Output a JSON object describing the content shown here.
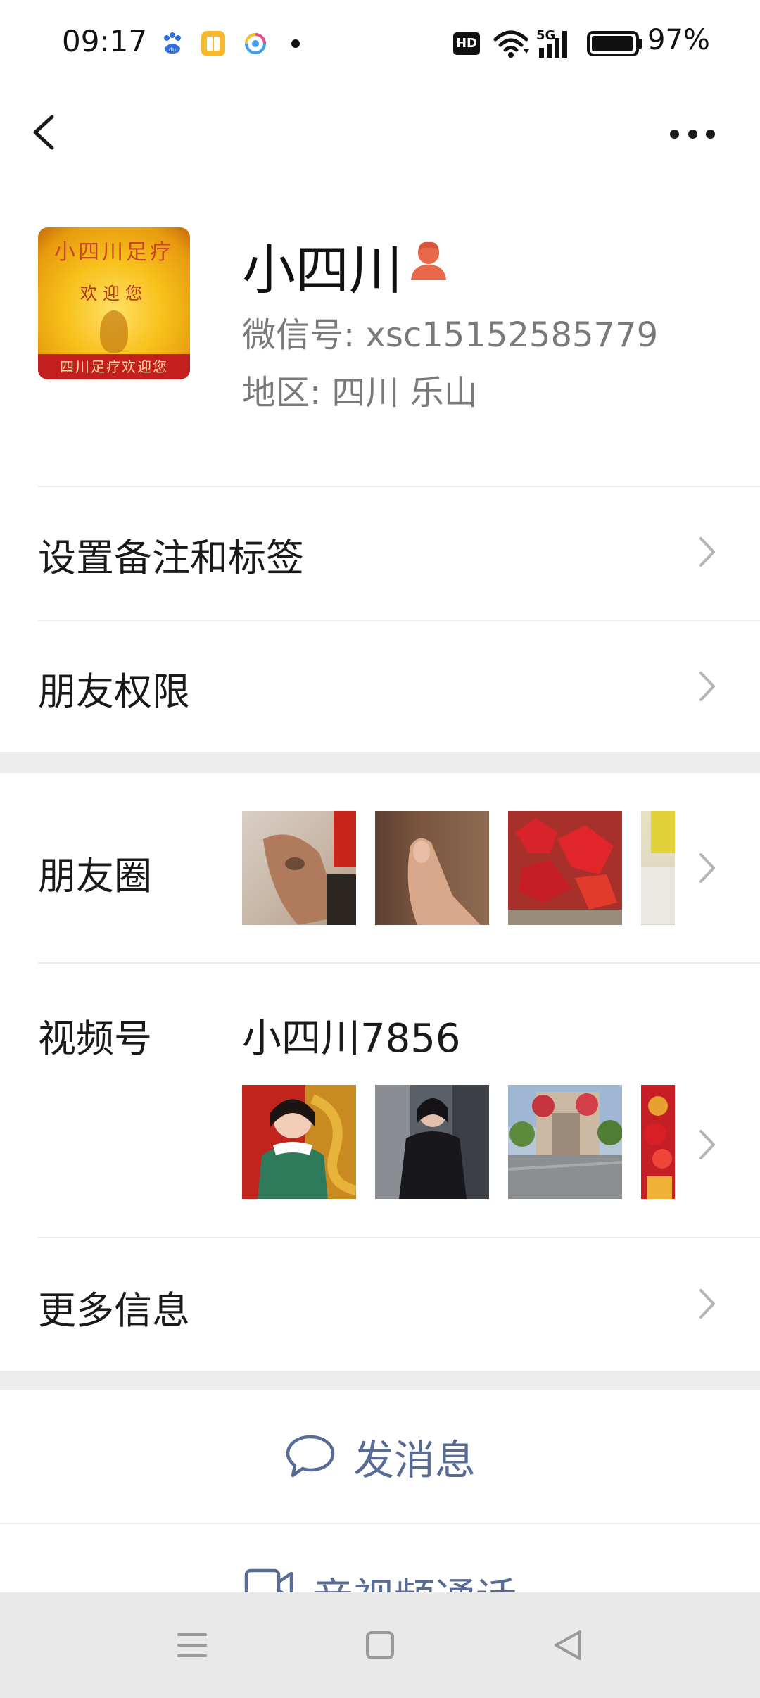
{
  "status_bar": {
    "time": "09:17",
    "hd": "HD",
    "network": "5G",
    "battery_level": 97,
    "battery": "97%",
    "icons": [
      "baidu-app-icon",
      "notes-app-icon",
      "browser-app-icon",
      "notification-dot-icon",
      "wifi-icon",
      "signal-icon",
      "battery-icon"
    ]
  },
  "nav": {
    "back_icon": "chevron-left-icon",
    "more_icon": "more-dots-icon"
  },
  "profile": {
    "name": "小四川",
    "wechat_id": "微信号:  xsc15152585779",
    "region": "地区:  四川  乐山",
    "avatar_text_top": "小四川足疗",
    "avatar_text_mid": "欢迎您",
    "avatar_text_band": "四川足疗欢迎您",
    "gender_icon": "person-icon",
    "gender_color": "#e8694a"
  },
  "menu": {
    "remarks_tags": "设置备注和标签",
    "friend_permissions": "朋友权限",
    "moments": "朋友圈",
    "channels": "视频号",
    "channels_name": "小四川7856",
    "more_info": "更多信息"
  },
  "actions": {
    "send_message": "发消息",
    "av_call": "音视频通话",
    "accent_color": "#576b95"
  },
  "system_nav": {
    "icons": [
      "menu-icon",
      "home-square-icon",
      "back-triangle-icon"
    ]
  }
}
